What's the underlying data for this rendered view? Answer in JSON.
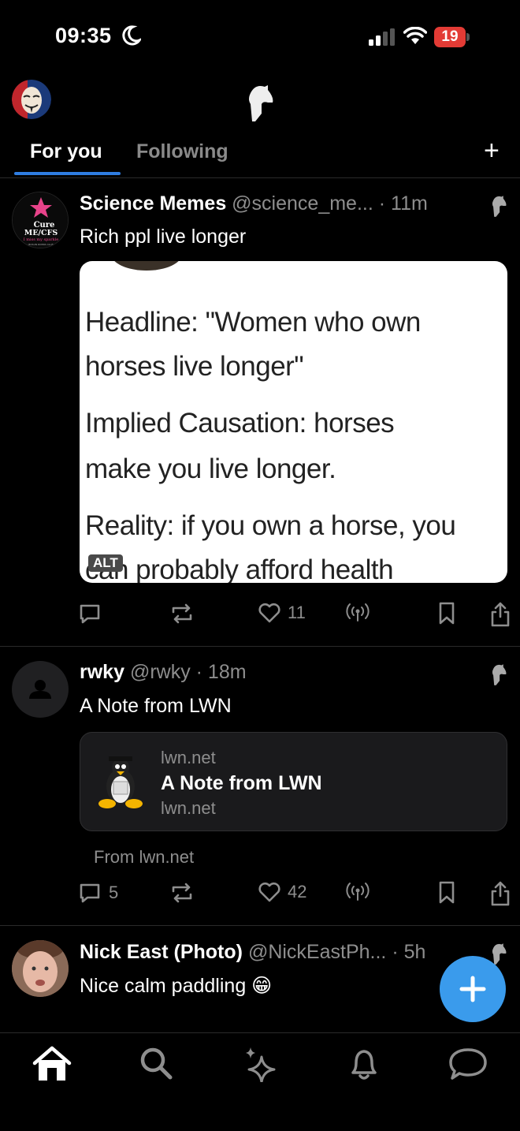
{
  "status_bar": {
    "time": "09:35",
    "battery": "19"
  },
  "header": {
    "logo_icon": "horse-logo-icon",
    "avatar_icon": "mask-avatar"
  },
  "tabs": [
    {
      "label": "For you",
      "active": true
    },
    {
      "label": "Following",
      "active": false
    }
  ],
  "add_feed_label": "+",
  "posts": [
    {
      "name": "Science Memes",
      "handle": "@science_me...",
      "time": "· 11m",
      "text": "Rich ppl live longer",
      "avatar_text": [
        "Cure",
        "ME/CFS",
        "I miss my sparkle",
        "• BOSUN RIVERS CLUB •"
      ],
      "image_lines": [
        "Headline: \"Women who own",
        "horses live longer\"",
        "Implied  Causation:   horses",
        "make you live longer.",
        "Reality: if you own a horse, you",
        "can probably afford health"
      ],
      "alt_label": "ALT",
      "reply_count": "",
      "like_count": "11"
    },
    {
      "name": "rwky",
      "handle": "@rwky",
      "time": "· 18m",
      "text": "A Note from LWN",
      "link_card": {
        "domain": "lwn.net",
        "title": "A Note from LWN",
        "url": "lwn.net"
      },
      "from_text": "From lwn.net",
      "reply_count": "5",
      "like_count": "42"
    },
    {
      "name": "Nick East (Photo)",
      "handle": "@NickEastPh...",
      "time": "· 5h",
      "text": "Nice calm paddling 😁"
    }
  ],
  "colors": {
    "accent": "#2f7de1",
    "fab": "#3a9bec",
    "battery": "#e33b35",
    "muted": "#8e8e8e"
  },
  "bottom_nav": [
    "home-icon",
    "search-icon",
    "sparkle-icon",
    "bell-icon",
    "chat-icon"
  ]
}
